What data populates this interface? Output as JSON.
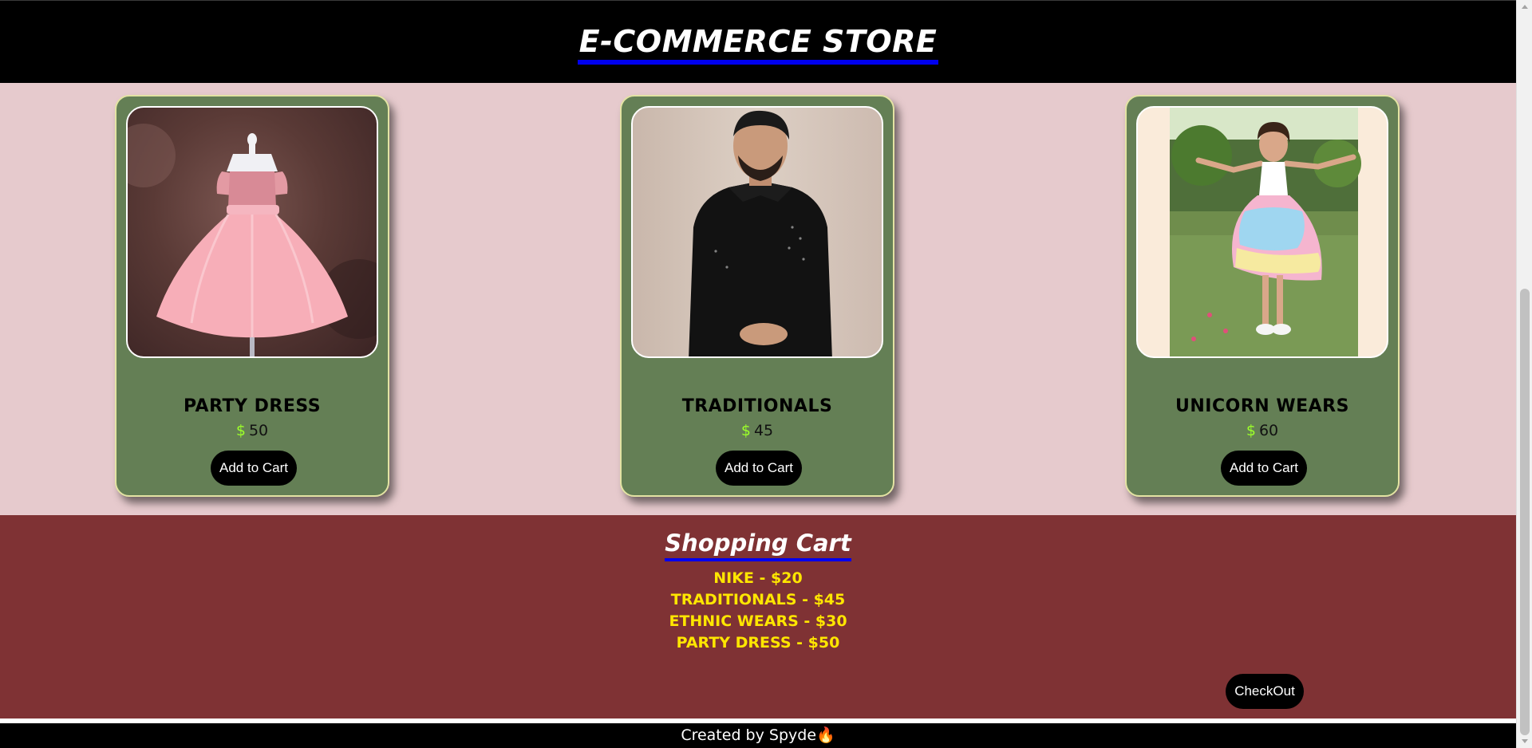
{
  "header": {
    "title": "E-COMMERCE STORE"
  },
  "products": [
    {
      "name": "PARTY DRESS",
      "currency": "$",
      "price": "50",
      "button_label": "Add to Cart",
      "image": "pink-party-dress-on-mannequin"
    },
    {
      "name": "TRADITIONALS",
      "currency": "$",
      "price": "45",
      "button_label": "Add to Cart",
      "image": "man-in-black-kurta"
    },
    {
      "name": "UNICORN WEARS",
      "currency": "$",
      "price": "60",
      "button_label": "Add to Cart",
      "image": "girl-in-rainbow-tutu-dress"
    }
  ],
  "cart": {
    "title": "Shopping Cart",
    "items": [
      "NIKE - $20",
      "TRADITIONALS - $45",
      "ETHNIC WEARS - $30",
      "PARTY DRESS - $50"
    ],
    "checkout_label": "CheckOut"
  },
  "footer": {
    "text": "Created by Spyde🔥"
  },
  "colors": {
    "header_bg": "#000000",
    "products_bg": "#e6cacd",
    "card_bg": "#647f55",
    "card_border": "#e3e3a3",
    "currency": "#9cff2a",
    "cart_bg": "#7f3234",
    "cart_item": "#ffe600",
    "underline": "#0000ee"
  }
}
